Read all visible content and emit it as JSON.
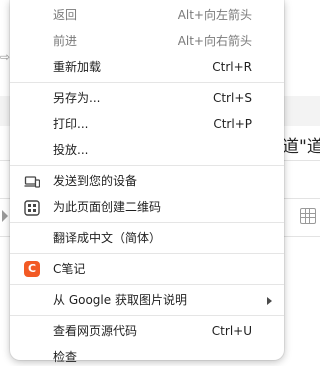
{
  "background": {
    "right_text": "道\"道"
  },
  "menu": {
    "items": [
      {
        "label": "返回",
        "shortcut": "Alt+向左箭头",
        "disabled": true
      },
      {
        "label": "前进",
        "shortcut": "Alt+向右箭头",
        "disabled": true
      },
      {
        "label": "重新加载",
        "shortcut": "Ctrl+R",
        "disabled": false
      },
      {
        "label": "另存为...",
        "shortcut": "Ctrl+S",
        "disabled": false
      },
      {
        "label": "打印...",
        "shortcut": "Ctrl+P",
        "disabled": false
      },
      {
        "label": "投放...",
        "shortcut": "",
        "disabled": false
      },
      {
        "label": "发送到您的设备",
        "icon": "laptop-phone-icon"
      },
      {
        "label": "为此页面创建二维码",
        "icon": "qr-code-icon"
      },
      {
        "label": "翻译成中文（简体）"
      },
      {
        "label": "C笔记",
        "icon": "c-note-icon",
        "icon_text": "C",
        "icon_color": "#f25a24"
      },
      {
        "label": "从 Google 获取图片说明",
        "has_submenu": true
      },
      {
        "label": "查看网页源代码",
        "shortcut": "Ctrl+U"
      },
      {
        "label": "检查",
        "shortcut": ""
      }
    ]
  }
}
